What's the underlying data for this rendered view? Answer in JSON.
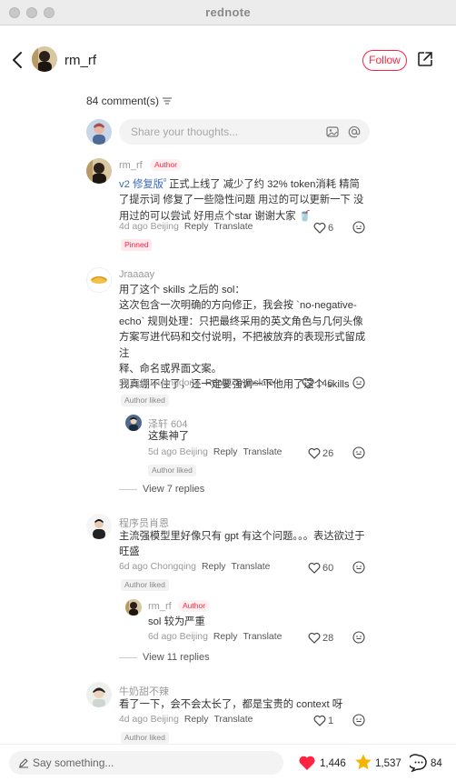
{
  "window": {
    "title": "rednote"
  },
  "header": {
    "username": "rm_rf",
    "follow_label": "Follow"
  },
  "comments_header": {
    "count_label": "84 comment(s)"
  },
  "composer": {
    "placeholder": "Share your thoughts..."
  },
  "comments": [
    {
      "name": "rm_rf",
      "author_tag": "Author",
      "link_text": "v2 修复版",
      "link_mark": "ᵍ",
      "text": " 正式上线了 减少了约 32% token消耗 精简了提示词 修复了一些隐性问题 用过的可以更新一下 没用过的可以尝试 好用点个star 谢谢大家",
      "emoji": "🥤",
      "meta": "4d ago Beijing",
      "reply": "Reply",
      "translate": "Translate",
      "likes": "6",
      "pinned_label": "Pinned"
    },
    {
      "name": "Jraaaay",
      "lines": [
        "用了这个 skills 之后的 sol：",
        "这次包含一次明确的方向修正，我会按 `no-negative-",
        "echo` 规则处理：只把最终采用的英文角色与几何头像",
        "方案写进代码和交付说明，不把被放弃的表现形式留成注",
        "释、命名或界面文案。",
        "我真绷不住了，还一定要强调一下他用了这个 skills"
      ],
      "meta": "5d ago Guangdong",
      "reply": "Reply",
      "translate": "Translate",
      "likes": "146",
      "liked_label": "Author liked",
      "sub_reply": {
        "name": "泽轩 604",
        "text": "这集神了",
        "meta": "5d ago Beijing",
        "reply": "Reply",
        "translate": "Translate",
        "likes": "26",
        "liked_label": "Author liked"
      },
      "view_replies": "View 7 replies"
    },
    {
      "name": "程序员肖恩",
      "lines": [
        "主流强模型里好像只有 gpt 有这个问题。。。表达欲过于",
        "旺盛"
      ],
      "meta": "6d ago Chongqing",
      "reply": "Reply",
      "translate": "Translate",
      "likes": "60",
      "liked_label": "Author liked",
      "sub_reply": {
        "name": "rm_rf",
        "author_tag": "Author",
        "text": "sol 较为严重",
        "meta": "6d ago Beijing",
        "reply": "Reply",
        "translate": "Translate",
        "likes": "28"
      },
      "view_replies": "View 11 replies"
    },
    {
      "name": "牛奶甜不辣",
      "text": "看了一下，会不会太长了，都是宝贵的 context 呀",
      "meta": "4d ago Beijing",
      "reply": "Reply",
      "translate": "Translate",
      "likes": "1",
      "liked_label": "Author liked"
    }
  ],
  "bottom_bar": {
    "placeholder": "Say something...",
    "likes": "1,446",
    "collects": "1,537",
    "comments": "84"
  },
  "colors": {
    "accent": "#ff2442",
    "link": "#3b6cb5",
    "star": "#f5b400"
  }
}
